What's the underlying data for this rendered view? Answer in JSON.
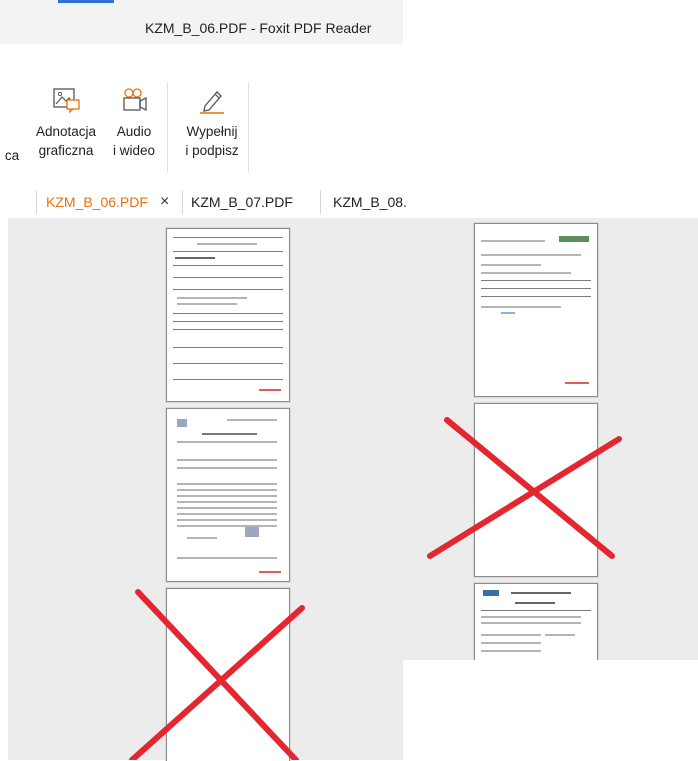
{
  "window": {
    "title": "KZM_B_06.PDF - Foxit PDF Reader"
  },
  "ribbon": {
    "cut_label": "ca",
    "buttons": [
      {
        "icon": "image-annotation-icon",
        "line1": "Adnotacja",
        "line2": "graficzna"
      },
      {
        "icon": "audio-video-icon",
        "line1": "Audio",
        "line2": "i wideo"
      },
      {
        "icon": "fill-sign-icon",
        "line1": "Wypełnij",
        "line2": "i podpisz"
      }
    ]
  },
  "tabs": [
    {
      "label": "KZM_B_06.PDF",
      "active": true,
      "close": "×"
    },
    {
      "label": "KZM_B_07.PDF",
      "active": false
    },
    {
      "label": "KZM_B_08.",
      "active": false
    }
  ],
  "colors": {
    "active_tab": "#e8720c",
    "cross": "#e3262f",
    "pane": "#ececec"
  }
}
